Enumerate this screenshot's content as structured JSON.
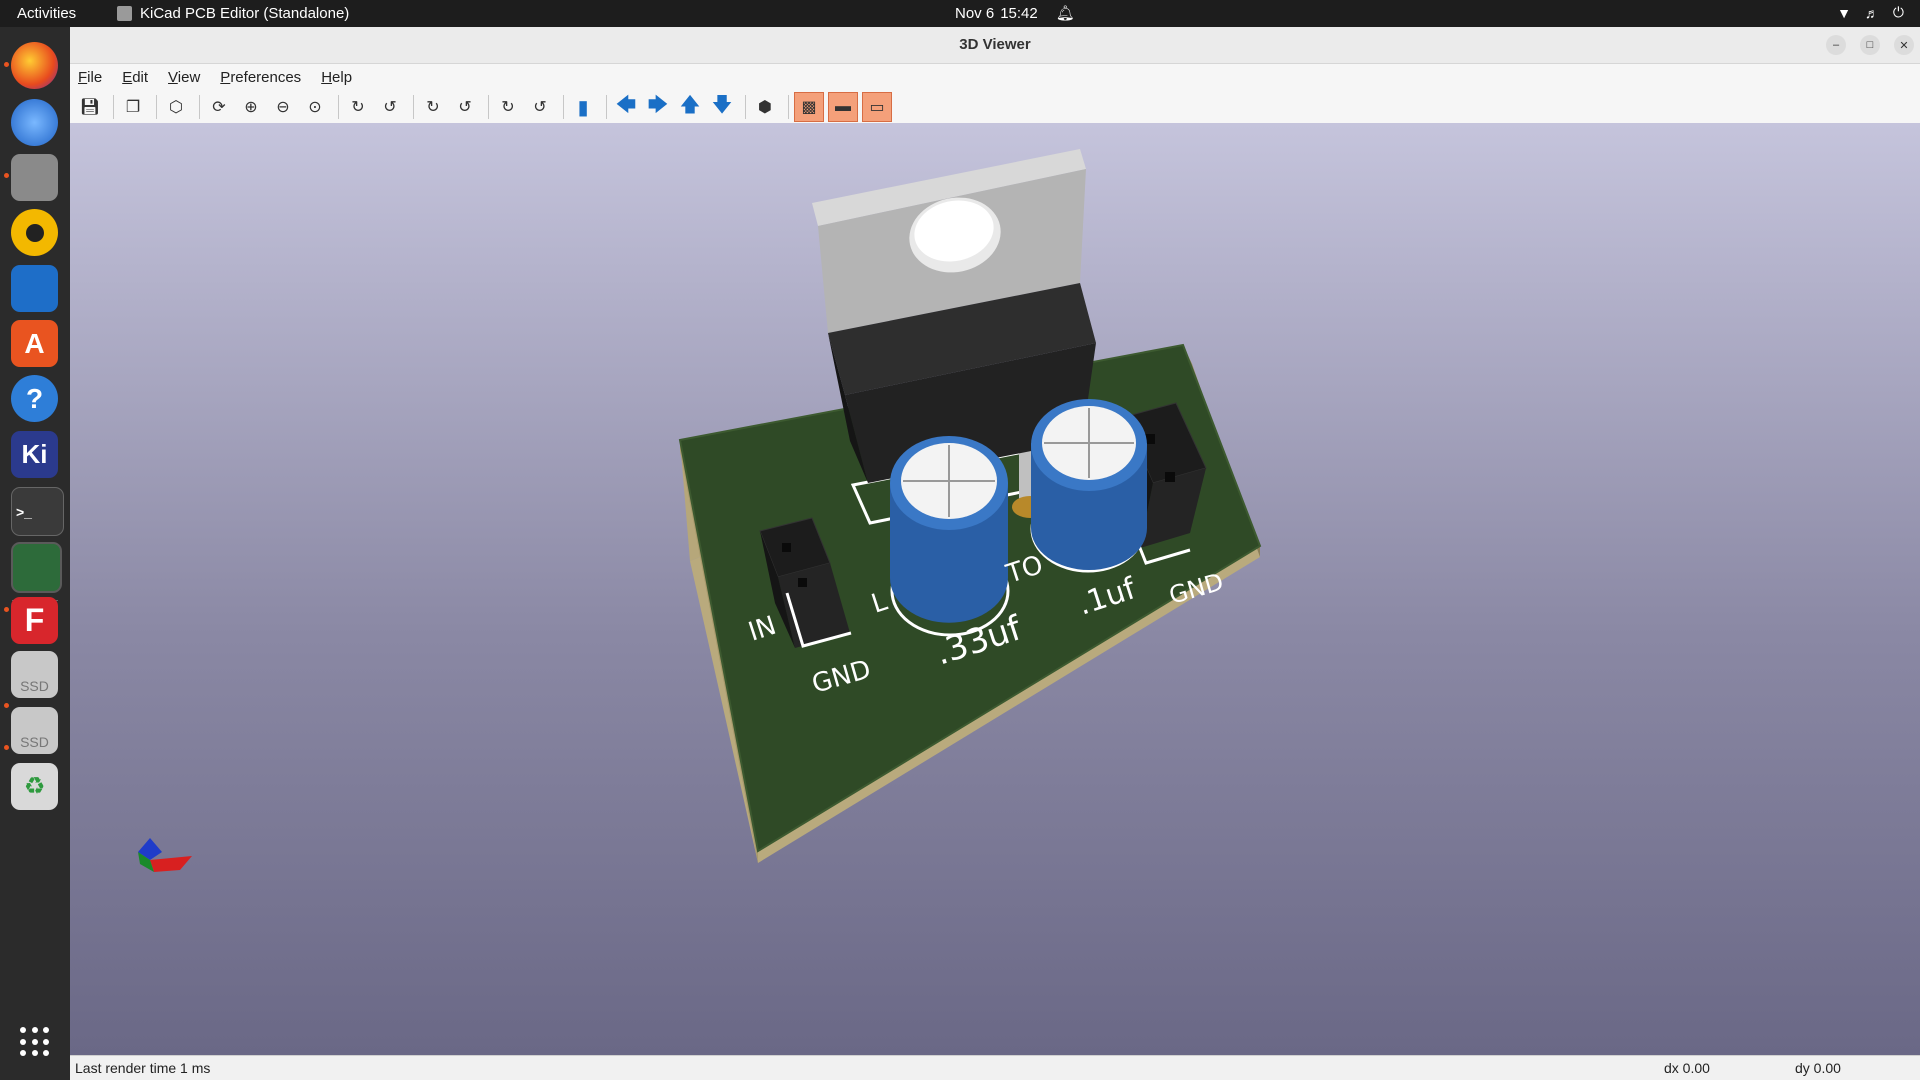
{
  "topbar": {
    "activities": "Activities",
    "app_name": "KiCad PCB Editor (Standalone)",
    "date": "Nov 6",
    "time": "15:42"
  },
  "dock": {
    "items": [
      "firefox-icon",
      "thunderbird-icon",
      "files-icon",
      "rhythmbox-icon",
      "writer-icon",
      "app-center-icon",
      "help-icon",
      "kicad-icon",
      "terminal-icon",
      "pcb-editor-icon",
      "freecad-icon",
      "ssd-drive-icon",
      "ssd-drive-icon",
      "trash-icon"
    ],
    "ssd_label": "SSD",
    "kicad_label": "Ki",
    "freecad_label": "F"
  },
  "window": {
    "title": "3D Viewer"
  },
  "menu": {
    "file": "File",
    "edit": "Edit",
    "view": "View",
    "preferences": "Preferences",
    "help": "Help"
  },
  "board": {
    "labels": {
      "input_gnd": "GND",
      "output_gnd": "GND",
      "cap1": ".33uf",
      "cap2": ".1uf",
      "in_prefix": "IN",
      "lm": "L",
      "to": "TO"
    },
    "colors": {
      "pcb": "#2f4a26",
      "pcb_edge": "#b6a77a",
      "regulator_body": "#252525",
      "regulator_tab": "#b4b4b4",
      "capacitor": "#2a5fa6",
      "silkscreen": "#ffffff"
    }
  },
  "status": {
    "render_time": "Last render time 1 ms",
    "dx": "dx 0.00",
    "dy": "dy 0.00"
  }
}
